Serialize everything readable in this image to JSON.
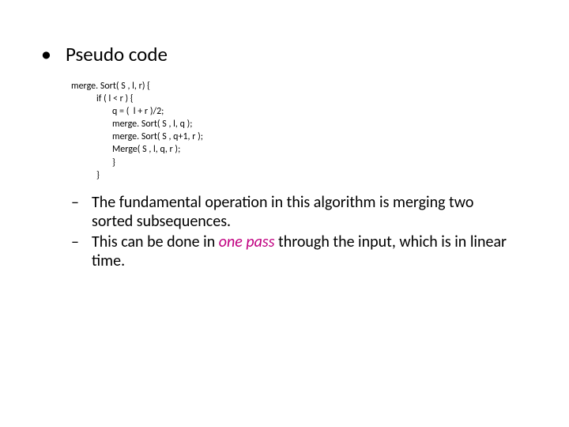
{
  "heading": "Pseudo code",
  "code": {
    "l1": "merge. Sort( S , l, r) {",
    "l2": "if ( l < r ) {",
    "l3": "q = (  l + r )/2;",
    "l4": "merge. Sort( S , l, q );",
    "l5": "merge. Sort( S , q+1, r );",
    "l6": "Merge( S , l, q, r );",
    "l7": "}",
    "l8": "}"
  },
  "sub1_a": "The fundamental operation in this algorithm is merging two",
  "sub1_b": "sorted subsequences.",
  "sub2_a": "This can be done in ",
  "sub2_em": "one pass",
  "sub2_b": " through the input, which is in linear",
  "sub2_c": "time.",
  "bullet_symbol": "•",
  "dash_symbol": "–"
}
